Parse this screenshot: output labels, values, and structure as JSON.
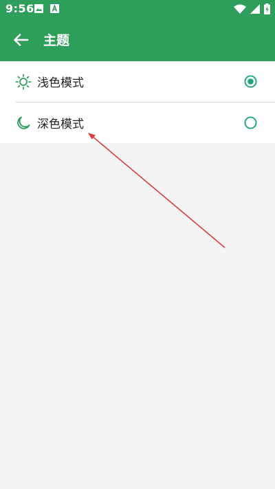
{
  "status_bar": {
    "time": "9:56",
    "left_icons": [
      "image-icon",
      "font-icon"
    ],
    "right_icons": [
      "wifi-icon",
      "signal-icon",
      "battery-charging-icon"
    ]
  },
  "app_bar": {
    "back_icon": "back-arrow-icon",
    "title": "主题"
  },
  "theme_options": [
    {
      "icon": "sun-icon",
      "label": "浅色模式",
      "selected": true
    },
    {
      "icon": "moon-icon",
      "label": "深色模式",
      "selected": false
    }
  ],
  "colors": {
    "primary": "#2e9e5b",
    "radio": "#1ea875",
    "annotation": "#e03c3c",
    "background": "#f4f4f4"
  }
}
